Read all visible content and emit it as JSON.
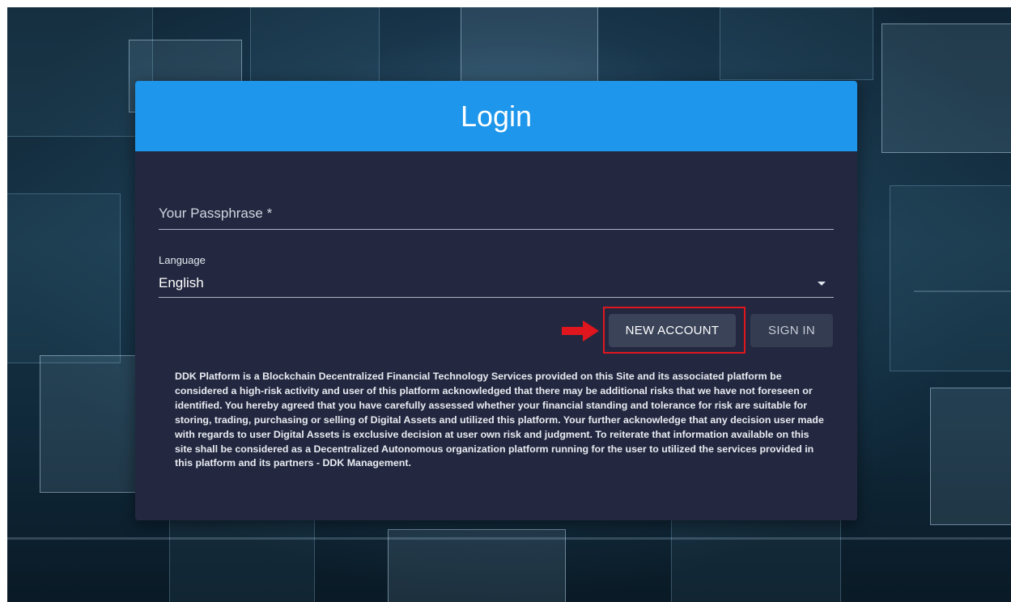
{
  "login": {
    "title": "Login",
    "passphrase_label": "Your Passphrase *",
    "language_label": "Language",
    "language_value": "English",
    "new_account_label": "NEW ACCOUNT",
    "sign_in_label": "SIGN IN",
    "disclaimer": "DDK Platform is a Blockchain Decentralized Financial Technology Services provided on this Site and its associated platform be considered a high-risk activity and user of this platform acknowledged that there may be additional risks that we have not foreseen or identified. You hereby agreed that you have carefully assessed whether your financial standing and tolerance for risk are suitable for storing, trading, purchasing or selling of Digital Assets and utilized this platform. Your further acknowledge that any decision user made with regards to user Digital Assets is exclusive decision at user own risk and judgment. To reiterate that information available on this site shall be considered as a Decentralized Autonomous organization platform running for the user to utilized the services provided in this platform and its partners - DDK Management."
  },
  "colors": {
    "header_blue": "#1e96eb",
    "card_bg": "#232840",
    "highlight_red": "#e0161e"
  },
  "icons": {
    "caret": "chevron-down-icon",
    "pointer": "arrow-right-icon"
  }
}
